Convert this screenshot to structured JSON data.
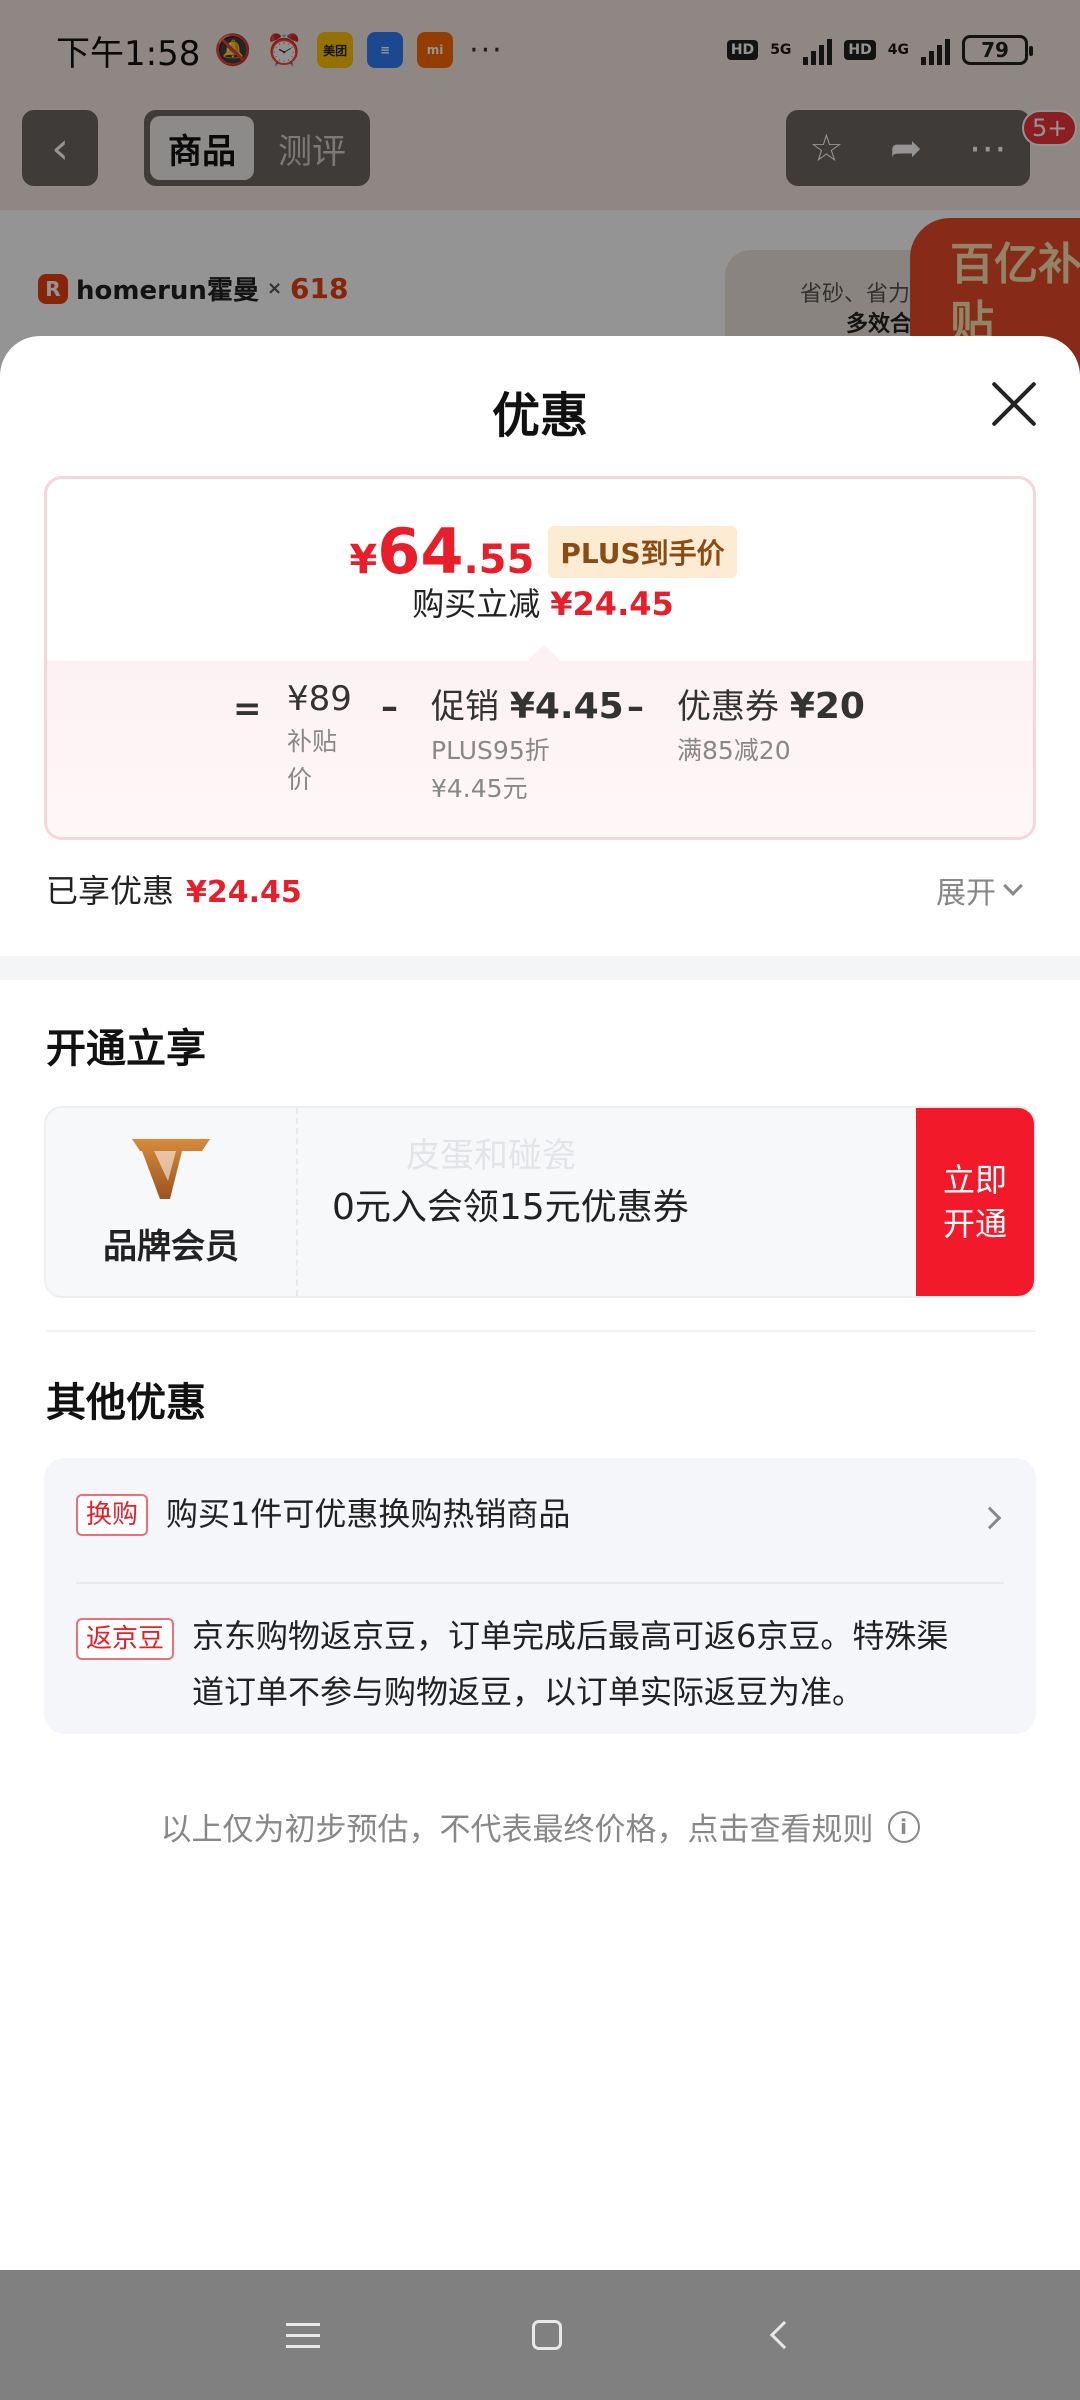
{
  "status_bar": {
    "time": "下午1:58",
    "apps": [
      "美团",
      "≡",
      "mi"
    ],
    "more": "···",
    "network_1": "5G",
    "network_2": "4G",
    "hd": "HD",
    "battery": "79"
  },
  "page_header": {
    "tabs": [
      {
        "label": "商品",
        "active": true
      },
      {
        "label": "测评",
        "active": false
      }
    ],
    "badge": "5+"
  },
  "background": {
    "brand": "homerun霍曼",
    "brand_x": "×",
    "brand_event": "618",
    "card_line1": "省砂、省力",
    "card_line2": "多效合",
    "promo_badge": "百亿补贴"
  },
  "sheet": {
    "title": "优惠",
    "final_price": {
      "currency": "¥",
      "integer": "64",
      "decimal": ".55",
      "tag": "PLUS到手价"
    },
    "instant_discount": {
      "label": "购买立减",
      "amount": "¥24.45"
    },
    "calc": {
      "equals": "=",
      "base": {
        "label": "¥89",
        "sub": "补贴价"
      },
      "minus": "–",
      "promo": {
        "label": "促销",
        "value": "¥4.45",
        "sub1": "PLUS95折",
        "sub2": "¥4.45元"
      },
      "coupon": {
        "label": "优惠券",
        "value": "¥20",
        "sub": "满85减20"
      }
    },
    "enjoyed": {
      "label": "已享优惠",
      "amount": "¥24.45"
    },
    "expand": "展开",
    "open_section": {
      "title": "开通立享",
      "card_name": "品牌会员",
      "watermark": "皮蛋和碰瓷",
      "text": "0元入会领15元优惠券",
      "button_line1": "立即",
      "button_line2": "开通"
    },
    "other_section": {
      "title": "其他优惠",
      "items": [
        {
          "tag": "换购",
          "text": "购买1件可优惠换购热销商品"
        },
        {
          "tag": "返京豆",
          "text": "京东购物返京豆，订单完成后最高可返6京豆。特殊渠道订单不参与购物返豆，以订单实际返豆为准。"
        }
      ]
    },
    "footnote": "以上仅为初步预估，不代表最终价格，点击查看规则"
  },
  "colors": {
    "accent_red": "#e81f2b",
    "plus_gold": "#8a4c15",
    "button_red": "#f2192a"
  }
}
